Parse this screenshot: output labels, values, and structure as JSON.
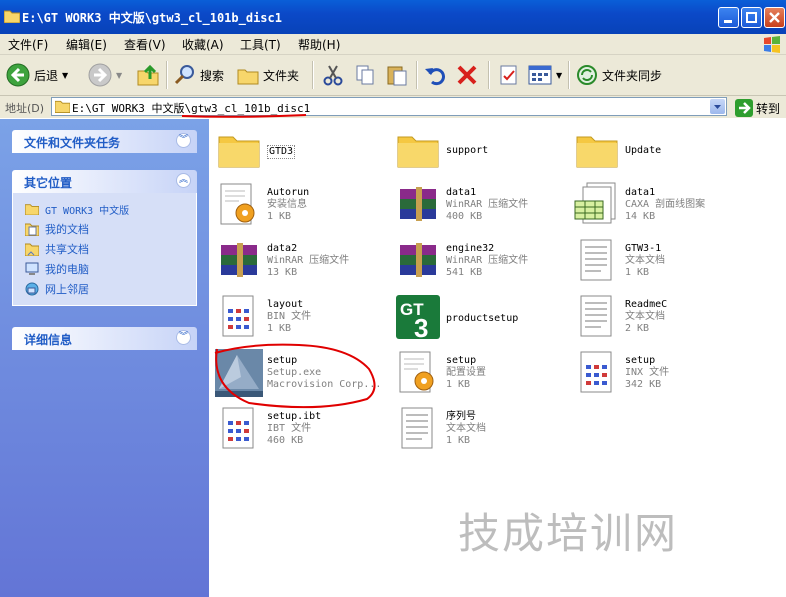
{
  "window": {
    "title": "E:\\GT WORK3 中文版\\gtw3_cl_101b_disc1"
  },
  "menu": [
    "文件(F)",
    "编辑(E)",
    "查看(V)",
    "收藏(A)",
    "工具(T)",
    "帮助(H)"
  ],
  "toolbar": {
    "back": "后退",
    "search": "搜索",
    "folders": "文件夹",
    "sync": "文件夹同步"
  },
  "address": {
    "label": "地址(D)",
    "value": "E:\\GT WORK3 中文版\\gtw3_cl_101b_disc1",
    "go": "转到"
  },
  "panels": {
    "tasks": {
      "title": "文件和文件夹任务"
    },
    "places": {
      "title": "其它位置",
      "items": [
        "GT WORK3 中文版",
        "我的文档",
        "共享文档",
        "我的电脑",
        "网上邻居"
      ]
    },
    "details": {
      "title": "详细信息"
    }
  },
  "files": [
    {
      "name": "GTD3",
      "line2": "",
      "line3": "",
      "icon": "folder"
    },
    {
      "name": "support",
      "line2": "",
      "line3": "",
      "icon": "folder"
    },
    {
      "name": "Update",
      "line2": "",
      "line3": "",
      "icon": "folder"
    },
    {
      "name": "Autorun",
      "line2": "安装信息",
      "line3": "1 KB",
      "icon": "setup-info"
    },
    {
      "name": "data1",
      "line2": "WinRAR 压缩文件",
      "line3": "400 KB",
      "icon": "winrar"
    },
    {
      "name": "data1",
      "line2": "CAXA 剖面线图案",
      "line3": "14 KB",
      "icon": "caxa"
    },
    {
      "name": "data2",
      "line2": "WinRAR 压缩文件",
      "line3": "13 KB",
      "icon": "winrar"
    },
    {
      "name": "engine32",
      "line2": "WinRAR 压缩文件",
      "line3": "541 KB",
      "icon": "winrar"
    },
    {
      "name": "GTW3-1",
      "line2": "文本文档",
      "line3": "1 KB",
      "icon": "text"
    },
    {
      "name": "layout",
      "line2": "BIN 文件",
      "line3": "1 KB",
      "icon": "binary"
    },
    {
      "name": "productsetup",
      "line2": "",
      "line3": "",
      "icon": "gt3"
    },
    {
      "name": "ReadmeC",
      "line2": "文本文档",
      "line3": "2 KB",
      "icon": "text"
    },
    {
      "name": "setup",
      "line2": "Setup.exe",
      "line3": "Macrovision Corp...",
      "icon": "setup-exe"
    },
    {
      "name": "setup",
      "line2": "配置设置",
      "line3": "1 KB",
      "icon": "setup-info"
    },
    {
      "name": "setup",
      "line2": "INX 文件",
      "line3": "342 KB",
      "icon": "binary"
    },
    {
      "name": "setup.ibt",
      "line2": "IBT 文件",
      "line3": "460 KB",
      "icon": "binary"
    },
    {
      "name": "序列号",
      "line2": "文本文档",
      "line3": "1 KB",
      "icon": "text"
    }
  ],
  "watermark": "技成培训网",
  "colors": {
    "titlebar": "#0a5fd8",
    "leftpane": "#6f8de0",
    "highlight": "#e00000"
  }
}
